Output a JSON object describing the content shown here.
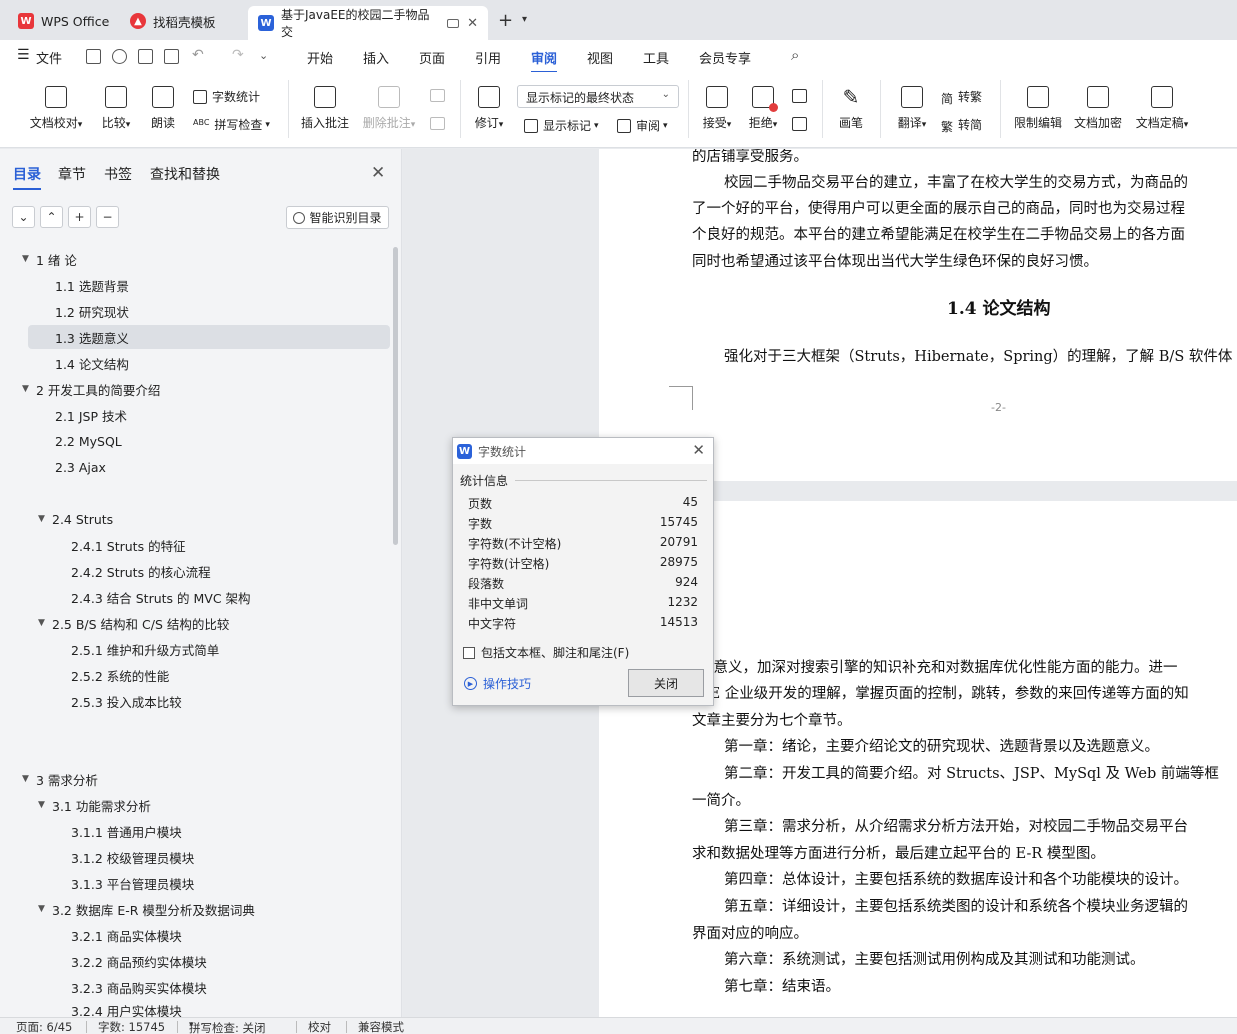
{
  "tabs": [
    {
      "label": "WPS Office",
      "icon": "wps-logo-icon",
      "color": "#e8363b"
    },
    {
      "label": "找稻壳模板",
      "icon": "docer-icon",
      "color": "#e8363b"
    },
    {
      "label": "基于JavaEE的校园二手物品交",
      "icon": "word-doc-icon",
      "color": "#2b62d9"
    }
  ],
  "menu": {
    "file": "文件",
    "items": [
      "开始",
      "插入",
      "页面",
      "引用",
      "审阅",
      "视图",
      "工具",
      "会员专享"
    ],
    "active": "审阅"
  },
  "ribbon": {
    "doc_check": "文档校对",
    "compare": "比较",
    "read_aloud": "朗读",
    "word_count": "字数统计",
    "spell_check": "拼写检查",
    "insert_comment": "插入批注",
    "delete_comment": "删除批注",
    "revise": "修订",
    "markup_state": "显示标记的最终状态",
    "show_markup": "显示标记",
    "review": "审阅",
    "accept": "接受",
    "reject": "拒绝",
    "pen": "画笔",
    "translate": "翻译",
    "to_traditional": "转繁",
    "to_simplified": "转简",
    "restrict_edit": "限制编辑",
    "encrypt": "文档加密",
    "finalize": "文档定稿"
  },
  "nav": {
    "tabs": [
      "目录",
      "章节",
      "书签",
      "查找和替换"
    ],
    "smart_toc": "智能识别目录",
    "toc": [
      {
        "label": "1  绪  论",
        "level": 1,
        "expanded": true
      },
      {
        "label": "1.1  选题背景",
        "level": 2
      },
      {
        "label": "1.2  研究现状",
        "level": 2
      },
      {
        "label": "1.3 选题意义",
        "level": 2,
        "selected": true
      },
      {
        "label": "1.4 论文结构",
        "level": 2
      },
      {
        "label": "2  开发工具的简要介绍",
        "level": 1,
        "expanded": true
      },
      {
        "label": "2.1 JSP 技术",
        "level": 2
      },
      {
        "label": "2.2 MySQL",
        "level": 2
      },
      {
        "label": "2.3 Ajax",
        "level": 2
      },
      {
        "label": "2.4 Struts",
        "level": 2,
        "expanded": true
      },
      {
        "label": "2.4.1 Struts 的特征",
        "level": 3
      },
      {
        "label": "2.4.2 Struts 的核心流程",
        "level": 3
      },
      {
        "label": "2.4.3  结合 Struts 的 MVC 架构",
        "level": 3
      },
      {
        "label": "2.5 B/S 结构和 C/S 结构的比较",
        "level": 2,
        "expanded": true
      },
      {
        "label": "2.5.1  维护和升级方式简单",
        "level": 3
      },
      {
        "label": "2.5.2  系统的性能",
        "level": 3
      },
      {
        "label": "2.5.3  投入成本比较",
        "level": 3
      },
      {
        "label": "3  需求分析",
        "level": 1,
        "expanded": true
      },
      {
        "label": "3.1 功能需求分析",
        "level": 2,
        "expanded": true
      },
      {
        "label": "3.1.1  普通用户模块",
        "level": 3
      },
      {
        "label": "3.1.2  校级管理员模块",
        "level": 3
      },
      {
        "label": "3.1.3  平台管理员模块",
        "level": 3
      },
      {
        "label": "3.2 数据库 E-R 模型分析及数据词典",
        "level": 2,
        "expanded": true
      },
      {
        "label": "3.2.1  商品实体模块",
        "level": 3
      },
      {
        "label": "3.2.2  商品预约实体模块",
        "level": 3
      },
      {
        "label": "3.2.3  商品购买实体模块",
        "level": 3
      },
      {
        "label": "3.2.4  用户实体模块",
        "level": 3
      }
    ]
  },
  "doc": {
    "page1_lines": [
      "的店铺享受服务。",
      "校园二手物品交易平台的建立，丰富了在校大学生的交易方式，为商品的",
      "了一个好的平台，使得用户可以更全面的展示自己的商品，同时也为交易过程",
      "个良好的规范。本平台的建立希望能满足在校学生在二手物品交易上的各方面",
      "同时也希望通过该平台体现出当代大学生绿色环保的良好习惯。"
    ],
    "heading": "1.4 论文结构",
    "heading_para": "强化对于三大框架（Struts，Hibernate，Spring）的理解，了解 B/S 软件体",
    "page_number": "-2-",
    "page2_lines": [
      "际意义，加深对搜索引擎的知识补充和对数据库优化性能方面的能力。进一",
      "EE 企业级开发的理解，掌握页面的控制，跳转，参数的来回传递等方面的知",
      "文章主要分为七个章节。",
      "第一章：绪论，主要介绍论文的研究现状、选题背景以及选题意义。",
      "第二章：开发工具的简要介绍。对 Structs、JSP、MySql 及 Web 前端等框",
      "一简介。",
      "第三章：需求分析，从介绍需求分析方法开始，对校园二手物品交易平台",
      "求和数据处理等方面进行分析，最后建立起平台的 E-R 模型图。",
      "第四章：总体设计，主要包括系统的数据库设计和各个功能模块的设计。",
      "第五章：详细设计，主要包括系统类图的设计和系统各个模块业务逻辑的",
      "界面对应的响应。",
      "第六章：系统测试，主要包括测试用例构成及其测试和功能测试。",
      "第七章：结束语。"
    ]
  },
  "dialog": {
    "title": "字数统计",
    "group": "统计信息",
    "stats": [
      {
        "label": "页数",
        "value": "45"
      },
      {
        "label": "字数",
        "value": "15745"
      },
      {
        "label": "字符数(不计空格)",
        "value": "20791"
      },
      {
        "label": "字符数(计空格)",
        "value": "28975"
      },
      {
        "label": "段落数",
        "value": "924"
      },
      {
        "label": "非中文单词",
        "value": "1232"
      },
      {
        "label": "中文字符",
        "value": "14513"
      }
    ],
    "checkbox": "包括文本框、脚注和尾注(F)",
    "tips": "操作技巧",
    "close": "关闭"
  },
  "status": {
    "page": "页面: 6/45",
    "words": "字数: 15745",
    "spell": "拼写检查: 关闭",
    "proof": "校对",
    "compat": "兼容模式"
  }
}
